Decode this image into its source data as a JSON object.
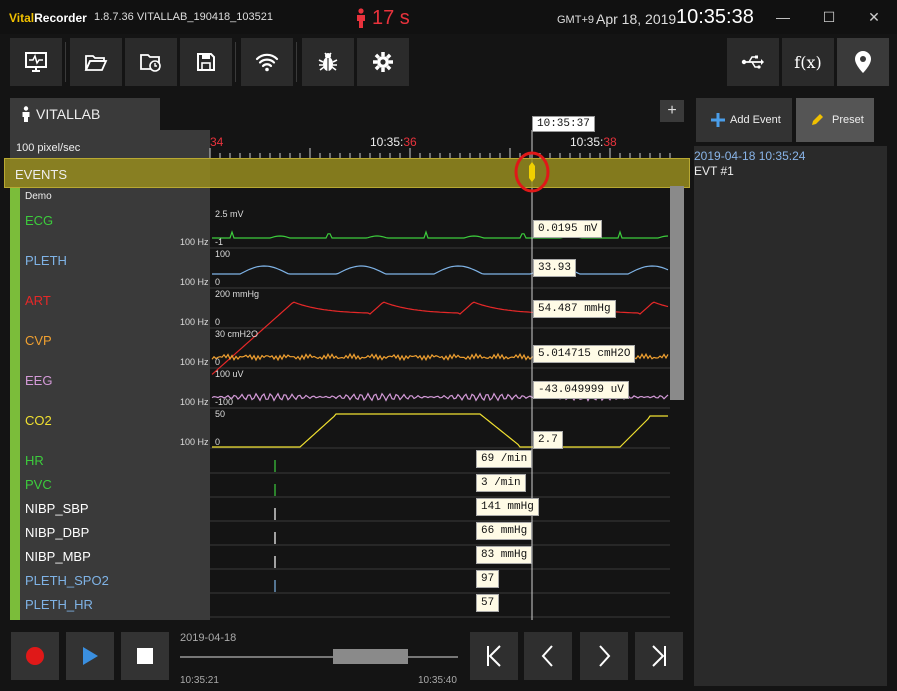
{
  "app": {
    "brand_v": "Vital",
    "brand_r": "Recorder",
    "version_title": "1.8.7.36 VITALLAB_190418_103521",
    "timer": "17 s",
    "timezone": "GMT+9",
    "date": "Apr 18, 2019",
    "clock": "10:35:38"
  },
  "window_controls": [
    "minimize",
    "maximize",
    "close"
  ],
  "toolbar": {
    "left": [
      "monitor-icon",
      "folder-open-icon",
      "folder-clock-icon",
      "save-icon",
      "wifi-icon",
      "bug-icon",
      "gear-icon"
    ],
    "right": [
      "usb-icon",
      "function-icon",
      "location-pin-icon"
    ],
    "function_label": "f(x)"
  },
  "track_tab": {
    "label": "VITALLAB",
    "add_label": "+"
  },
  "scale_label": "100 pixel/sec",
  "ruler": {
    "labels": [
      {
        "prefix": "",
        "suffix": "34"
      },
      {
        "prefix": "10:35:",
        "suffix": "36"
      },
      {
        "prefix": "10:35:",
        "suffix": "38"
      }
    ],
    "cursor_time": "10:35:37"
  },
  "events_label": "EVENTS",
  "group_label": "Demo",
  "tracks": [
    {
      "name": "ECG",
      "color": "#3ccc3c",
      "hz": "100 Hz",
      "ymax": "2.5 mV",
      "ymin": "-1",
      "value": "0.0195 mV"
    },
    {
      "name": "PLETH",
      "color": "#7fb3e6",
      "hz": "100 Hz",
      "ymax": "100",
      "ymin": "0",
      "value": "33.93"
    },
    {
      "name": "ART",
      "color": "#e62828",
      "hz": "100 Hz",
      "ymax": "200 mmHg",
      "ymin": "0",
      "value": "54.487 mmHg"
    },
    {
      "name": "CVP",
      "color": "#f0a030",
      "hz": "100 Hz",
      "ymax": "30 cmH2O",
      "ymin": "0",
      "value": "5.014715 cmH2O"
    },
    {
      "name": "EEG",
      "color": "#d49ad8",
      "hz": "100 Hz",
      "ymax": "100 uV",
      "ymin": "-100",
      "value": "-43.049999 uV"
    },
    {
      "name": "CO2",
      "color": "#f0e030",
      "hz": "100 Hz",
      "ymax": "50",
      "ymin": "0",
      "value": "2.7"
    }
  ],
  "numerics": [
    {
      "name": "HR",
      "color": "#3ccc3c",
      "value": "69 /min"
    },
    {
      "name": "PVC",
      "color": "#3ccc3c",
      "value": "3 /min"
    },
    {
      "name": "NIBP_SBP",
      "color": "#ffffff",
      "value": "141 mmHg"
    },
    {
      "name": "NIBP_DBP",
      "color": "#ffffff",
      "value": "66 mmHg"
    },
    {
      "name": "NIBP_MBP",
      "color": "#ffffff",
      "value": "83 mmHg"
    },
    {
      "name": "PLETH_SPO2",
      "color": "#7fb3e6",
      "value": "97"
    },
    {
      "name": "PLETH_HR",
      "color": "#7fb3e6",
      "value": "57"
    }
  ],
  "right_panel": {
    "add_event_label": "Add Event",
    "preset_label": "Preset",
    "event_time": "2019-04-18 10:35:24",
    "event_name": "EVT #1"
  },
  "playback": {
    "date": "2019-04-18",
    "start": "10:35:21",
    "end": "10:35:40",
    "position": 0.73
  },
  "colors": {
    "accent_red": "#e8323c",
    "brand_yellow": "#f0c000",
    "event_band": "#968c1e"
  }
}
